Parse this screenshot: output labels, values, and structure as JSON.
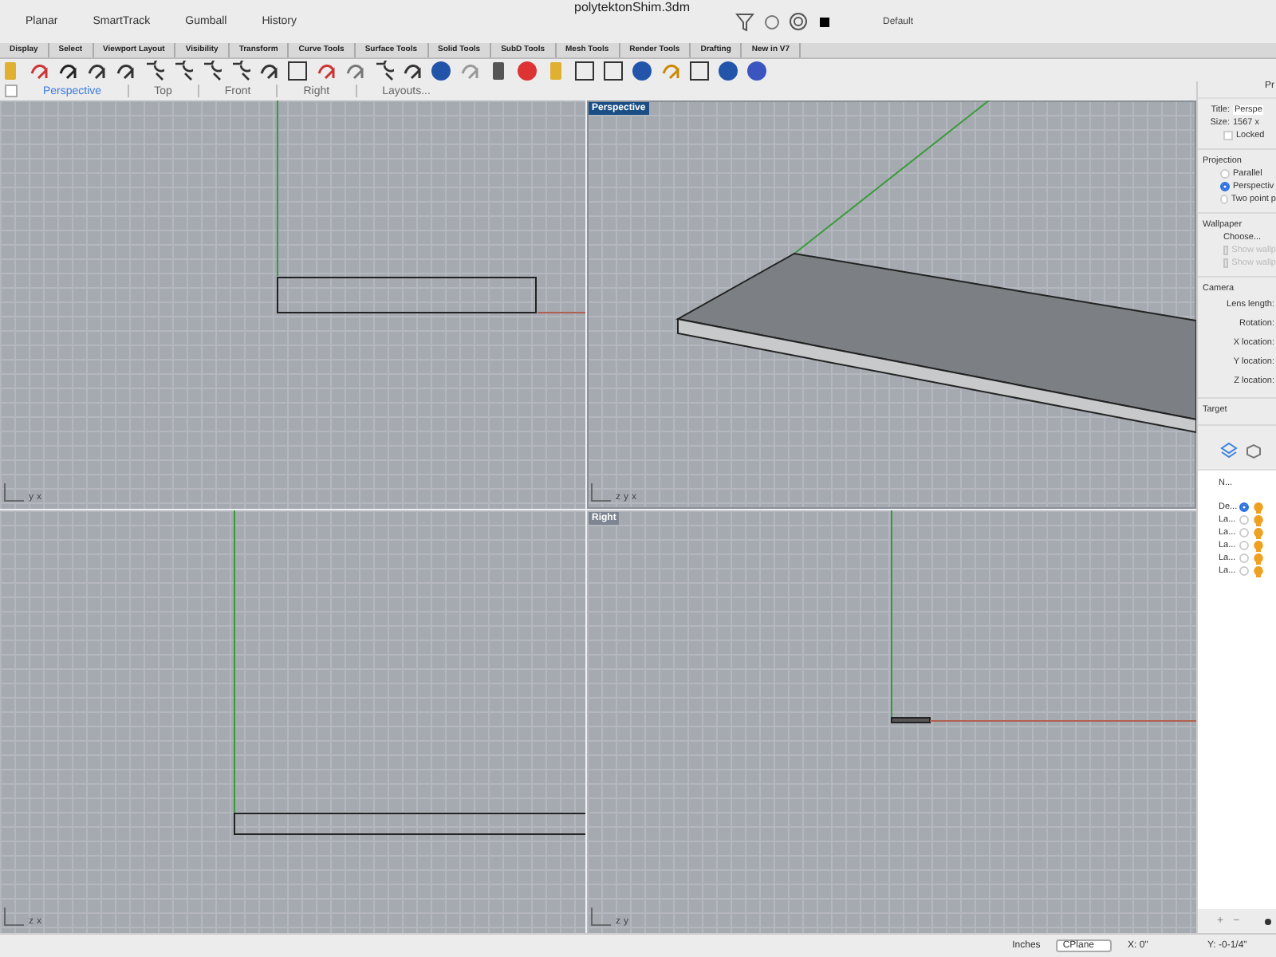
{
  "window": {
    "title": "polytektonShim.3dm"
  },
  "menu": [
    "Planar",
    "SmartTrack",
    "Gumball",
    "History"
  ],
  "layer_box": {
    "value": "Default"
  },
  "toolbar_tabs": [
    {
      "label": "Display",
      "selected": false
    },
    {
      "label": "Select",
      "selected": false
    },
    {
      "label": "Viewport Layout",
      "selected": false
    },
    {
      "label": "Visibility",
      "selected": false
    },
    {
      "label": "Transform",
      "selected": false
    },
    {
      "label": "Curve Tools",
      "selected": false
    },
    {
      "label": "Surface Tools",
      "selected": false
    },
    {
      "label": "Solid Tools",
      "selected": false
    },
    {
      "label": "SubD Tools",
      "selected": false
    },
    {
      "label": "Mesh Tools",
      "selected": false
    },
    {
      "label": "Render Tools",
      "selected": false
    },
    {
      "label": "Drafting",
      "selected": false
    },
    {
      "label": "New in V7",
      "selected": false
    }
  ],
  "viewport_checkbox": {
    "checked": false
  },
  "viewport_tabs": [
    {
      "label": "Perspective",
      "selected": true
    },
    {
      "label": "Top",
      "selected": false
    },
    {
      "label": "Front",
      "selected": false
    },
    {
      "label": "Right",
      "selected": false
    },
    {
      "label": "Layouts...",
      "selected": false
    }
  ],
  "viewports": [
    {
      "kind": "top",
      "selected": false,
      "axes": [
        "y",
        "x"
      ]
    },
    {
      "kind": "perspective",
      "label": "Perspective",
      "selected": true,
      "axes": [
        "z",
        "y",
        "x"
      ]
    },
    {
      "kind": "front",
      "selected": false,
      "axes": [
        "z",
        "x"
      ]
    },
    {
      "kind": "right",
      "label": "Right",
      "selected": false,
      "axes": [
        "z",
        "y"
      ]
    }
  ],
  "properties": {
    "header": "Pr",
    "title_label": "Title:",
    "title_value": "Perspe",
    "size_label": "Size:",
    "size_value": "1567 x",
    "locked": {
      "label": "Locked",
      "checked": false
    },
    "projection": {
      "heading": "Projection",
      "options": [
        {
          "label": "Parallel",
          "selected": false
        },
        {
          "label": "Perspectiv",
          "selected": true
        },
        {
          "label": "Two point p",
          "selected": false
        }
      ]
    },
    "wallpaper": {
      "heading": "Wallpaper",
      "button": "Choose...",
      "options": [
        {
          "label": "Show wallp",
          "checked": false,
          "disabled": true
        },
        {
          "label": "Show wallp",
          "checked": false,
          "disabled": true
        }
      ]
    },
    "camera": {
      "heading": "Camera",
      "fields": [
        "Lens length:",
        "Rotation:",
        "X location:",
        "Y location:",
        "Z location:"
      ]
    },
    "target": "Target"
  },
  "layers": {
    "column": "N...",
    "rows": [
      {
        "name": "De...",
        "selected": true
      },
      {
        "name": "La...",
        "selected": false
      },
      {
        "name": "La...",
        "selected": false
      },
      {
        "name": "La...",
        "selected": false
      },
      {
        "name": "La...",
        "selected": false
      },
      {
        "name": "La...",
        "selected": false
      }
    ],
    "add": "+",
    "remove": "−"
  },
  "status_bar": {
    "units": "Inches",
    "cplane": "CPlane",
    "x": "X: 0\"",
    "y": "Y: -0-1/4\""
  }
}
